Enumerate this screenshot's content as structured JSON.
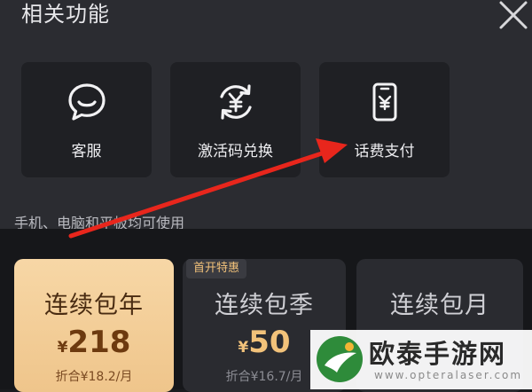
{
  "sheet": {
    "title": "相关功能",
    "tiles": [
      {
        "label": "客服",
        "icon": "chat-bubble-icon"
      },
      {
        "label": "激活码兑换",
        "icon": "yuan-exchange-icon"
      },
      {
        "label": "话费支付",
        "icon": "phone-bill-icon"
      }
    ]
  },
  "caption": "手机、电脑和平板均可使用",
  "plans": [
    {
      "name": "连续包年",
      "currency": "¥",
      "price": "218",
      "per": "折合¥18.2/月",
      "badge": ""
    },
    {
      "name": "连续包季",
      "currency": "¥",
      "price": "50",
      "per": "折合¥16.7/月",
      "badge": "首开特惠"
    },
    {
      "name": "连续包月",
      "currency": "",
      "price": "",
      "per": "",
      "badge": ""
    }
  ],
  "watermark": {
    "brand": "欧泰手游网",
    "url": "www.opteralaser.com"
  },
  "colors": {
    "accent_gold": "#f2c27a",
    "annotation_arrow": "#e8261c"
  }
}
